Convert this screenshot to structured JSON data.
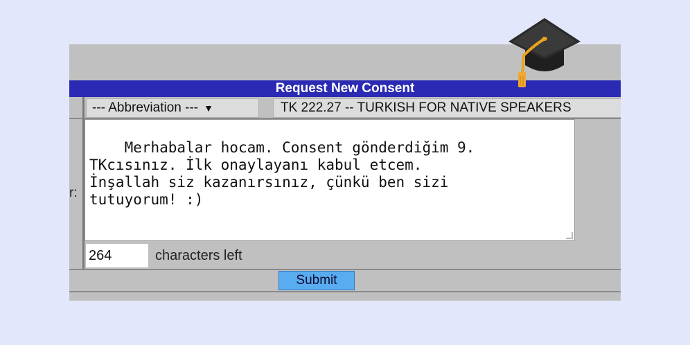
{
  "form": {
    "title": "Request New Consent",
    "label_fragment": "r:",
    "abbreviation_select": "--- Abbreviation ---",
    "course_value": "TK 222.27 -- TURKISH FOR NATIVE SPEAKERS",
    "message": "Merhabalar hocam. Consent gönderdiğim 9.\nTKcısınız. İlk onaylayanı kabul etcem.\nİnşallah siz kazanırsınız, çünkü ben sizi\ntutuyorum! :)",
    "characters_left_value": "264",
    "characters_left_label": "characters left",
    "submit_label": "Submit"
  },
  "icons": {
    "select_arrow": "chevron-down-icon",
    "graduation_cap": "graduation-cap-icon"
  },
  "colors": {
    "page_background": "#e3e7fc",
    "panel_background": "#c0c0c0",
    "title_bar": "#2a2ab4",
    "submit_button": "#5aacf0"
  }
}
